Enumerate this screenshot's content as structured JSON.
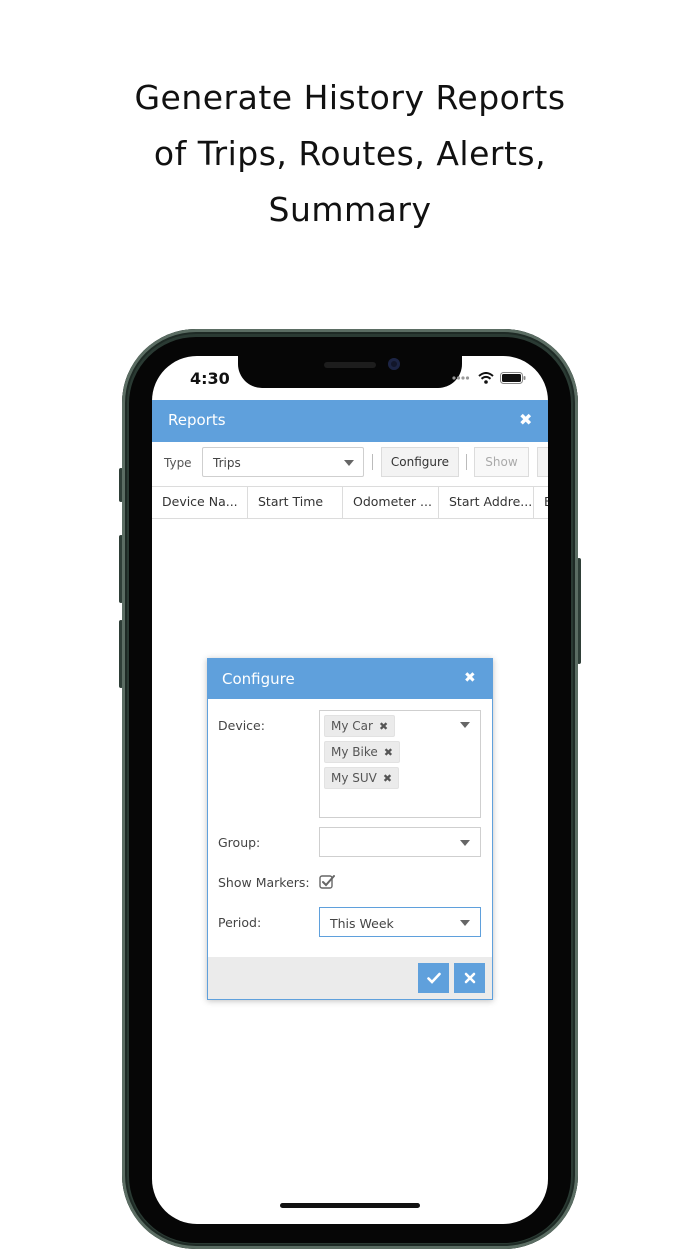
{
  "headline": {
    "line1": "Generate History Reports",
    "line2": "of Trips, Routes, Alerts,",
    "line3": "Summary"
  },
  "status_bar": {
    "time": "4:30"
  },
  "reports_window": {
    "title": "Reports",
    "close_icon": "close-icon",
    "toolbar": {
      "type_label": "Type",
      "type_value": "Trips",
      "configure_label": "Configure",
      "show_label": "Show"
    },
    "columns": [
      "Device Na...",
      "Start Time",
      "Odometer ...",
      "Start Addre...",
      "E"
    ]
  },
  "configure_dialog": {
    "title": "Configure",
    "device_label": "Device:",
    "devices": [
      "My Car",
      "My Bike",
      "My SUV"
    ],
    "group_label": "Group:",
    "group_value": "",
    "show_markers_label": "Show Markers:",
    "show_markers_checked": true,
    "period_label": "Period:",
    "period_value": "This Week",
    "confirm_icon": "checkmark-icon",
    "cancel_icon": "close-icon"
  },
  "colors": {
    "accent": "#5fa0dc",
    "phone_frame": "#2a3a33"
  }
}
